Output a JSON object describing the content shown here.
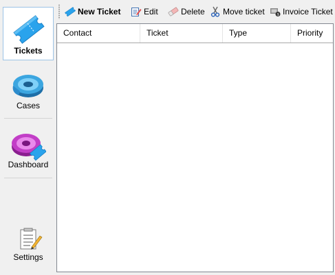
{
  "sidebar": {
    "items": [
      {
        "label": "Tickets",
        "icon": "ticket-icon"
      },
      {
        "label": "Cases",
        "icon": "cases-tape-icon"
      },
      {
        "label": "Dashboard",
        "icon": "dashboard-ticket-icon"
      },
      {
        "label": "Settings",
        "icon": "settings-checklist-icon"
      }
    ]
  },
  "toolbar": {
    "new_ticket": "New Ticket",
    "edit": "Edit",
    "delete": "Delete",
    "move_ticket": "Move ticket",
    "invoice_ticket": "Invoice Ticket"
  },
  "grid": {
    "columns": [
      "Contact",
      "Ticket",
      "Type",
      "Priority"
    ],
    "rows": []
  },
  "colors": {
    "accent_blue": "#2e9be6",
    "active_border": "#9cc3e6",
    "magenta": "#c23ec7"
  }
}
